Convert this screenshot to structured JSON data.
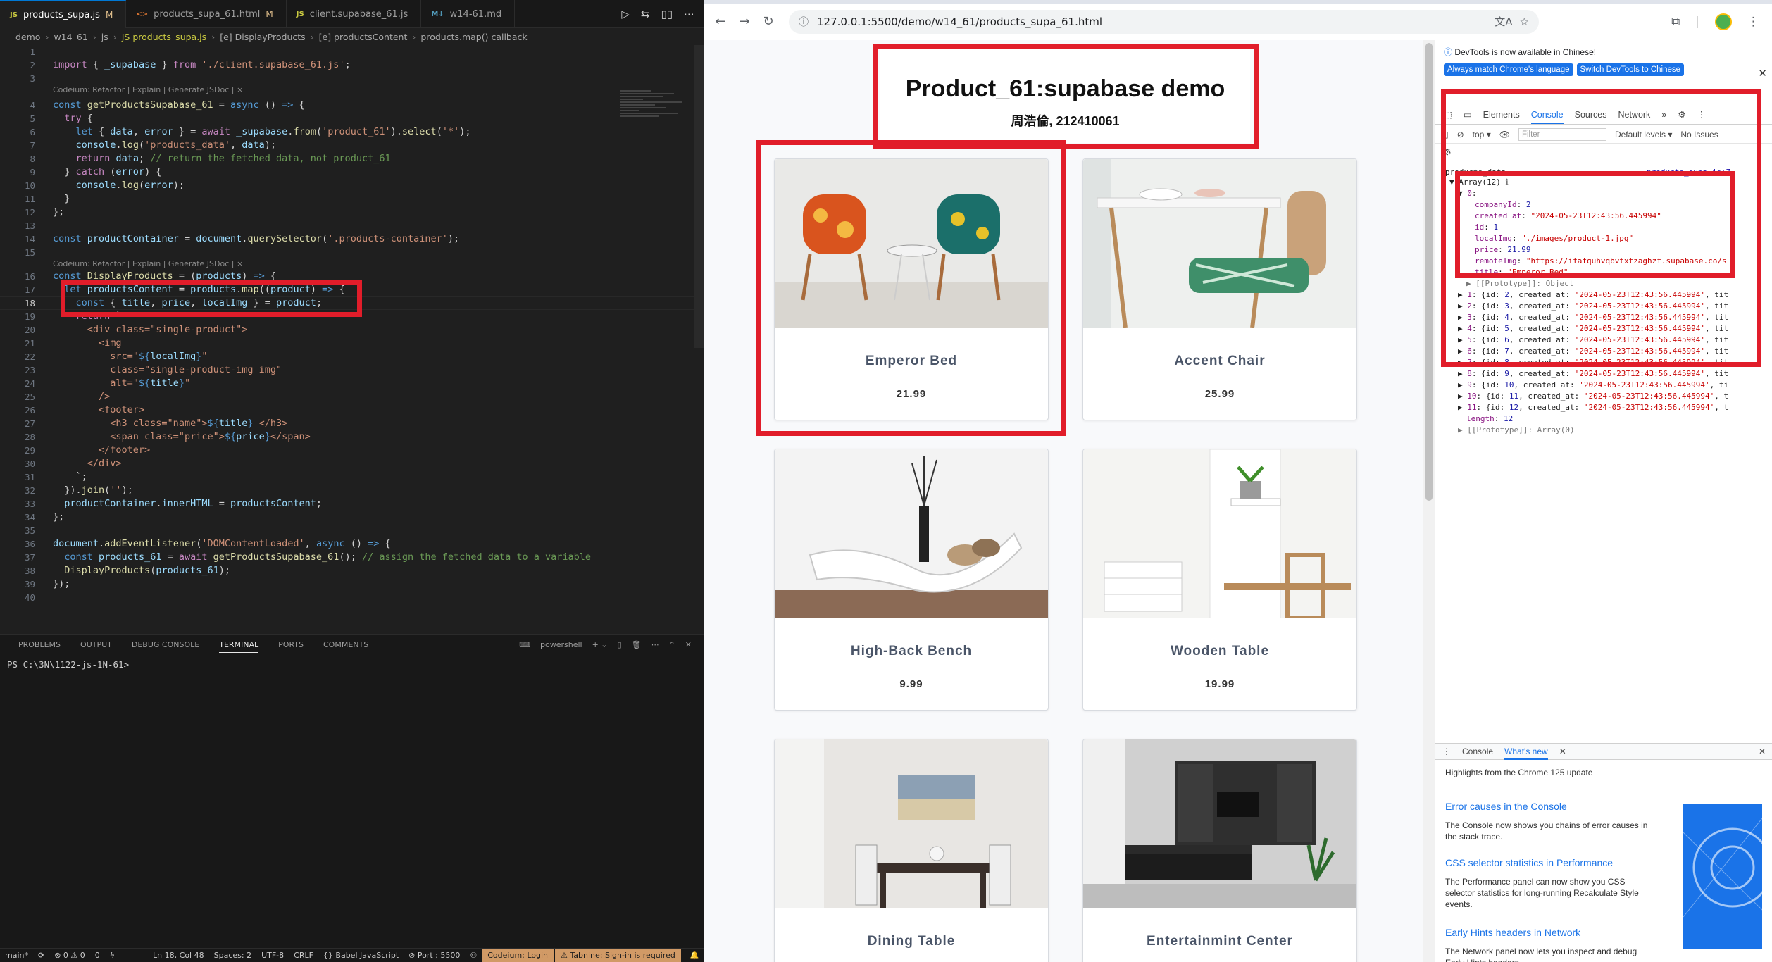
{
  "vscode": {
    "tabs": [
      {
        "lang": "JS",
        "name": "products_supa.js",
        "mod": "M",
        "active": true
      },
      {
        "lang": "<>",
        "name": "products_supa_61.html",
        "mod": "M",
        "active": false
      },
      {
        "lang": "JS",
        "name": "client.supabase_61.js",
        "mod": "",
        "active": false
      },
      {
        "lang": "M↓",
        "name": "w14-61.md",
        "mod": "",
        "active": false
      }
    ],
    "breadcrumb": [
      "demo",
      "w14_61",
      "js",
      "JS products_supa.js",
      "[e] DisplayProducts",
      "[e] productsContent",
      "products.map() callback"
    ],
    "lens_text": "Codeium: Refactor | Explain | Generate JSDoc | ×",
    "panel_tabs": [
      "PROBLEMS",
      "OUTPUT",
      "DEBUG CONSOLE",
      "TERMINAL",
      "PORTS",
      "COMMENTS"
    ],
    "panel_active": "TERMINAL",
    "terminal_shell": "powershell",
    "terminal_prompt": "PS C:\\3N\\1122-js-1N-61>",
    "status": {
      "branch": "main*",
      "problems": "⊗ 0 ⚠ 0",
      "ports_count": "0",
      "position": "Ln 18, Col 48",
      "spaces": "Spaces: 2",
      "encoding": "UTF-8",
      "eol": "CRLF",
      "language": "{} Babel JavaScript",
      "port": "⊘ Port : 5500",
      "codeium": "Codeium: Login",
      "tabnine": "⚠ Tabnine: Sign-in is required"
    }
  },
  "browser": {
    "url": "127.0.0.1:5500/demo/w14_61/products_supa_61.html",
    "page_title": "Product_61:supabase demo",
    "page_subtitle": "周浩倫, 212410061",
    "products": [
      {
        "title": "Emperor Bed",
        "price": "21.99"
      },
      {
        "title": "Accent Chair",
        "price": "25.99"
      },
      {
        "title": "High-Back Bench",
        "price": "9.99"
      },
      {
        "title": "Wooden Table",
        "price": "19.99"
      },
      {
        "title": "Dining Table",
        "price": ""
      },
      {
        "title": "Entertainmint Center",
        "price": ""
      }
    ]
  },
  "devtools": {
    "notice": "DevTools is now available in Chinese!",
    "notice_btn1": "Always match Chrome's language",
    "notice_btn2": "Switch DevTools to Chinese",
    "tabs": [
      "Elements",
      "Console",
      "Sources",
      "Network"
    ],
    "active_tab": "Console",
    "context": "top ▾",
    "filter_placeholder": "Filter",
    "levels": "Default levels ▾",
    "issues": "No Issues",
    "log_label": "products_data",
    "log_link": "products_supa.js:7",
    "drawer_tabs": [
      "Console",
      "What's new"
    ],
    "drawer_active": "What's new",
    "whats_new_intro": "Highlights from the Chrome 125 update",
    "whats_new": [
      {
        "title": "Error causes in the Console",
        "body": "The Console now shows you chains of error causes in the stack trace."
      },
      {
        "title": "CSS selector statistics in Performance",
        "body": "The Performance panel can now show you CSS selector statistics for long-running Recalculate Style events."
      },
      {
        "title": "Early Hints headers in Network",
        "body": "The Network panel now lets you inspect and debug Early Hints headers."
      }
    ]
  },
  "colors": {
    "accent_red": "#e11d2a",
    "vscode_blue": "#0078d4",
    "chrome_blue": "#1a73e8"
  }
}
